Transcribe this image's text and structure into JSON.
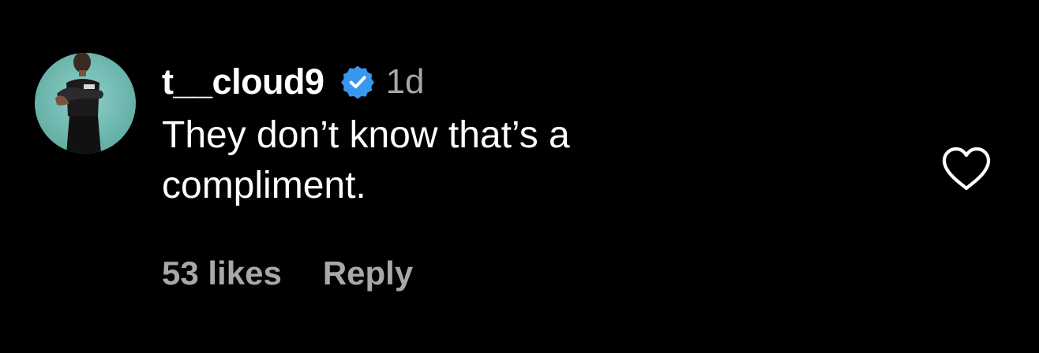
{
  "comment": {
    "username": "t__cloud9",
    "timestamp": "1d",
    "text": "They don’t know that’s a compliment.",
    "likes_label": "53 likes",
    "reply_label": "Reply"
  },
  "colors": {
    "background": "#000000",
    "text_primary": "#ffffff",
    "text_secondary": "#a8a8a8",
    "verified_badge": "#3897f0",
    "avatar_bg": "#6fb7b0"
  },
  "icons": {
    "verified": "verified-badge-icon",
    "like": "heart-outline-icon"
  }
}
